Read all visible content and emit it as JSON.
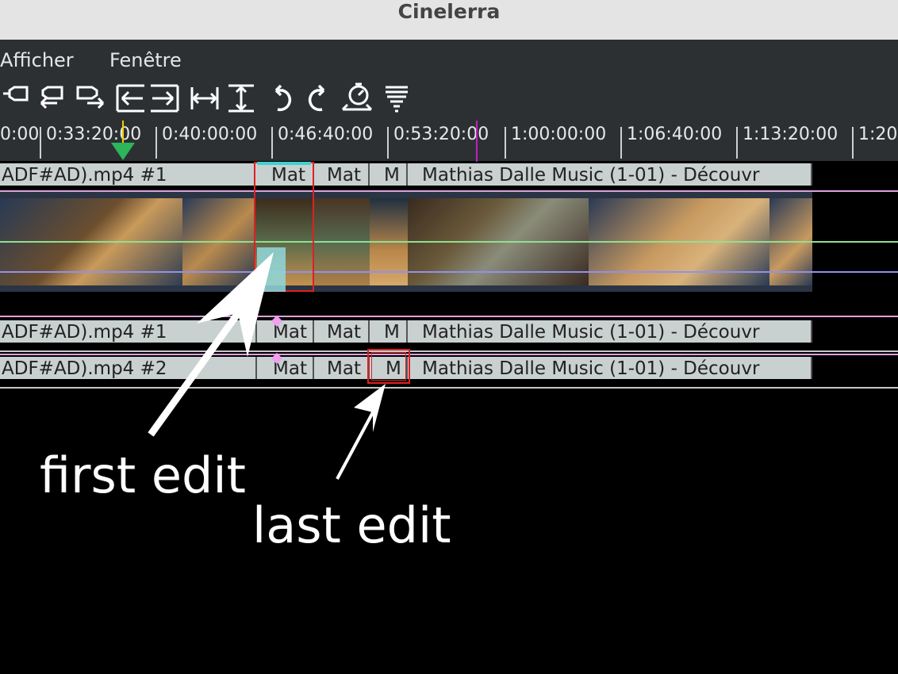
{
  "window": {
    "title": "Cinelerra"
  },
  "menu": [
    "Afficher",
    "Fenêtre"
  ],
  "toolbar": [
    {
      "icon": "label-icon"
    },
    {
      "icon": "prev-label-icon"
    },
    {
      "icon": "next-label-icon"
    },
    {
      "icon": "goto-start-icon"
    },
    {
      "icon": "goto-end-icon"
    },
    {
      "icon": "fit-horizontal-icon"
    },
    {
      "icon": "fit-vertical-icon"
    },
    {
      "icon": "undo-icon"
    },
    {
      "icon": "redo-icon"
    },
    {
      "icon": "speed-icon"
    },
    {
      "icon": "menu-lines-icon"
    }
  ],
  "timebar": {
    "ticks": [
      "0:00",
      "0:33:20:00",
      "0:40:00:00",
      "0:46:40:00",
      "0:53:20:00",
      "1:00:00:00",
      "1:06:40:00",
      "1:13:20:00",
      "1:20"
    ]
  },
  "tracks": {
    "video": {
      "edits": [
        "ADF#AD).mp4 #1",
        "Mat",
        "Mat",
        "M",
        "Mathias Dalle Music (1-01)  - Découvr"
      ]
    },
    "audio1": {
      "edits": [
        "ADF#AD).mp4 #1",
        "Mat",
        "Mat",
        "M",
        "Mathias Dalle Music (1-01)  - Découvr"
      ]
    },
    "audio2": {
      "edits": [
        "ADF#AD).mp4 #2",
        "Mat",
        "Mat",
        "M",
        "Mathias Dalle Music (1-01)  - Découvr"
      ]
    }
  },
  "annotations": {
    "first": "first edit",
    "last": "last edit"
  },
  "colors": {
    "selection": "#e02020",
    "cursor": "#c020c0",
    "playhead": "#f0d000",
    "in_marker": "#2cb55a",
    "line_green": "#90e090",
    "line_violet": "#9090f0",
    "line_pink": "#e0a0e0"
  }
}
